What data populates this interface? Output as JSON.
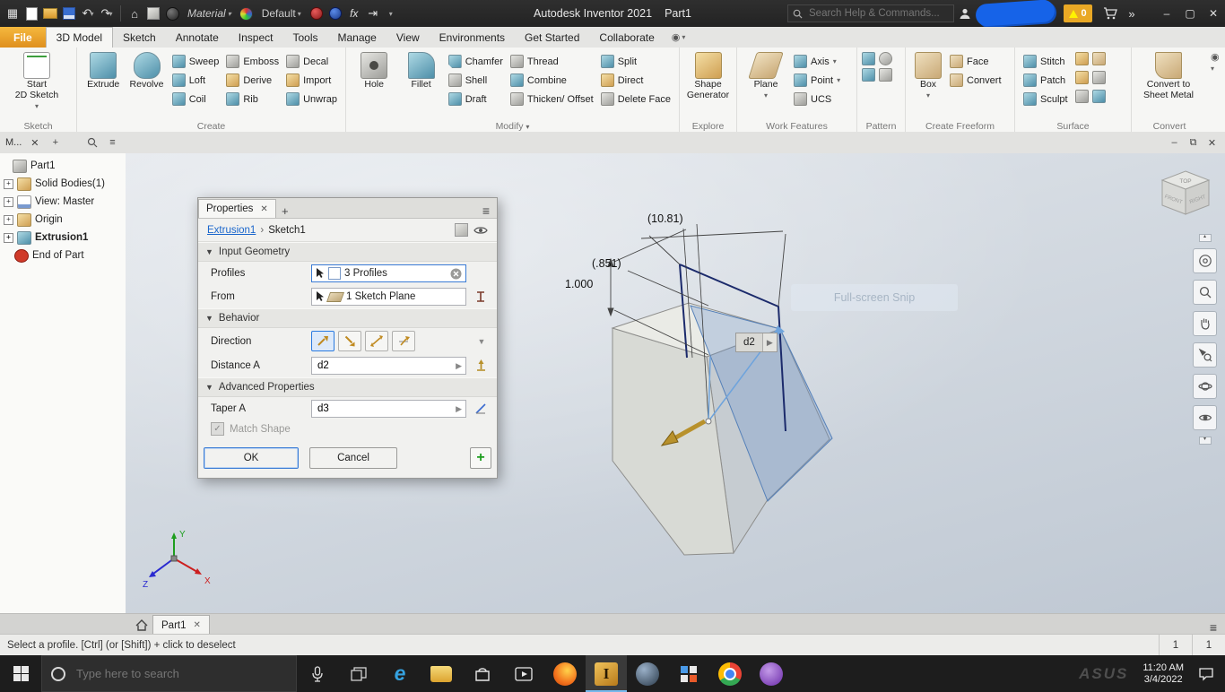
{
  "titlebar": {
    "material": "Material",
    "appearance": "Default",
    "fx": "fx",
    "app_title": "Autodesk Inventor 2021",
    "doc_name": "Part1",
    "search_placeholder": "Search Help & Commands...",
    "alert_count": "0"
  },
  "ribbon_tabs": [
    "File",
    "3D Model",
    "Sketch",
    "Annotate",
    "Inspect",
    "Tools",
    "Manage",
    "View",
    "Environments",
    "Get Started",
    "Collaborate"
  ],
  "ribbon": {
    "sketch": {
      "line1": "Start",
      "line2": "2D Sketch",
      "label": "Sketch"
    },
    "create": {
      "big": [
        "Extrude",
        "Revolve"
      ],
      "small": [
        "Sweep",
        "Loft",
        "Coil",
        "Emboss",
        "Derive",
        "Rib",
        "Decal",
        "Import",
        "Unwrap"
      ],
      "label": "Create"
    },
    "modify": {
      "big": [
        "Hole",
        "Fillet"
      ],
      "small": [
        "Chamfer",
        "Shell",
        "Draft",
        "Thread",
        "Combine",
        "Thicken/ Offset",
        "Split",
        "Direct",
        "Delete Face"
      ],
      "label": "Modify"
    },
    "explore": {
      "line1": "Shape",
      "line2": "Generator",
      "label": "Explore"
    },
    "work": {
      "big": "Plane",
      "small": [
        "Axis",
        "Point",
        "UCS"
      ],
      "label": "Work Features"
    },
    "pattern": {
      "label": "Pattern"
    },
    "freeform": {
      "big": "Box",
      "small": [
        "Face",
        "Convert"
      ],
      "label": "Create Freeform"
    },
    "surface": {
      "small": [
        "Stitch",
        "Patch",
        "Sculpt"
      ],
      "label": "Surface"
    },
    "convert": {
      "line1": "Convert to",
      "line2": "Sheet Metal",
      "label": "Convert"
    }
  },
  "browser": {
    "tab": "M...",
    "tree": [
      {
        "label": "Part1"
      },
      {
        "label": "Solid Bodies(1)"
      },
      {
        "label": "View: Master"
      },
      {
        "label": "Origin"
      },
      {
        "label": "Extrusion1"
      },
      {
        "label": "End of Part"
      }
    ]
  },
  "dialog": {
    "tab": "Properties",
    "breadcrumb_parent": "Extrusion1",
    "breadcrumb_child": "Sketch1",
    "sections": {
      "input": "Input Geometry",
      "behavior": "Behavior",
      "advanced": "Advanced Properties"
    },
    "profiles_label": "Profiles",
    "profiles_value": "3 Profiles",
    "from_label": "From",
    "from_value": "1 Sketch Plane",
    "direction_label": "Direction",
    "distance_label": "Distance A",
    "distance_value": "d2",
    "taper_label": "Taper A",
    "taper_value": "d3",
    "match_shape_label": "Match Shape",
    "ok": "OK",
    "cancel": "Cancel"
  },
  "viewport": {
    "dim_width": "(10.81)",
    "dim_depth": "(.851)",
    "dim_height": "1.000",
    "d2_tag": "d2",
    "snip_ghost": "Full-screen Snip",
    "viewcube": {
      "top": "TOP",
      "front": "FRONT",
      "right": "RIGHT"
    },
    "triad": {
      "x": "X",
      "y": "Y",
      "z": "Z"
    }
  },
  "doc_tabs": {
    "active": "Part1"
  },
  "statusbar": {
    "message": "Select a profile. [Ctrl] (or [Shift]) + click to deselect",
    "counter1": "1",
    "counter2": "1"
  },
  "taskbar": {
    "search_placeholder": "Type here to search",
    "time": "11:20 AM",
    "date": "3/4/2022",
    "watermark": "ASUS"
  },
  "icons": {
    "titlebar": [
      "app-menu",
      "new-file",
      "open-folder",
      "save",
      "undo",
      "redo",
      "home",
      "sketch-return",
      "material-sphere",
      "appearance-wheel",
      "adjust-color",
      "parameters-fx",
      "measure-arrow",
      "user",
      "alert-triangle",
      "cart",
      "overflow-chevrons",
      "minimize",
      "maximize",
      "close"
    ],
    "navbar": [
      "navigation-wheel",
      "zoom",
      "pan-hand",
      "zoom-window",
      "orbit",
      "look-at"
    ],
    "taskbar": [
      "start",
      "cortana",
      "microphone",
      "task-view",
      "edge",
      "file-explorer",
      "store",
      "media-player",
      "firefox",
      "inventor",
      "sphere-app",
      "grid-app",
      "chrome",
      "purple-app"
    ]
  }
}
